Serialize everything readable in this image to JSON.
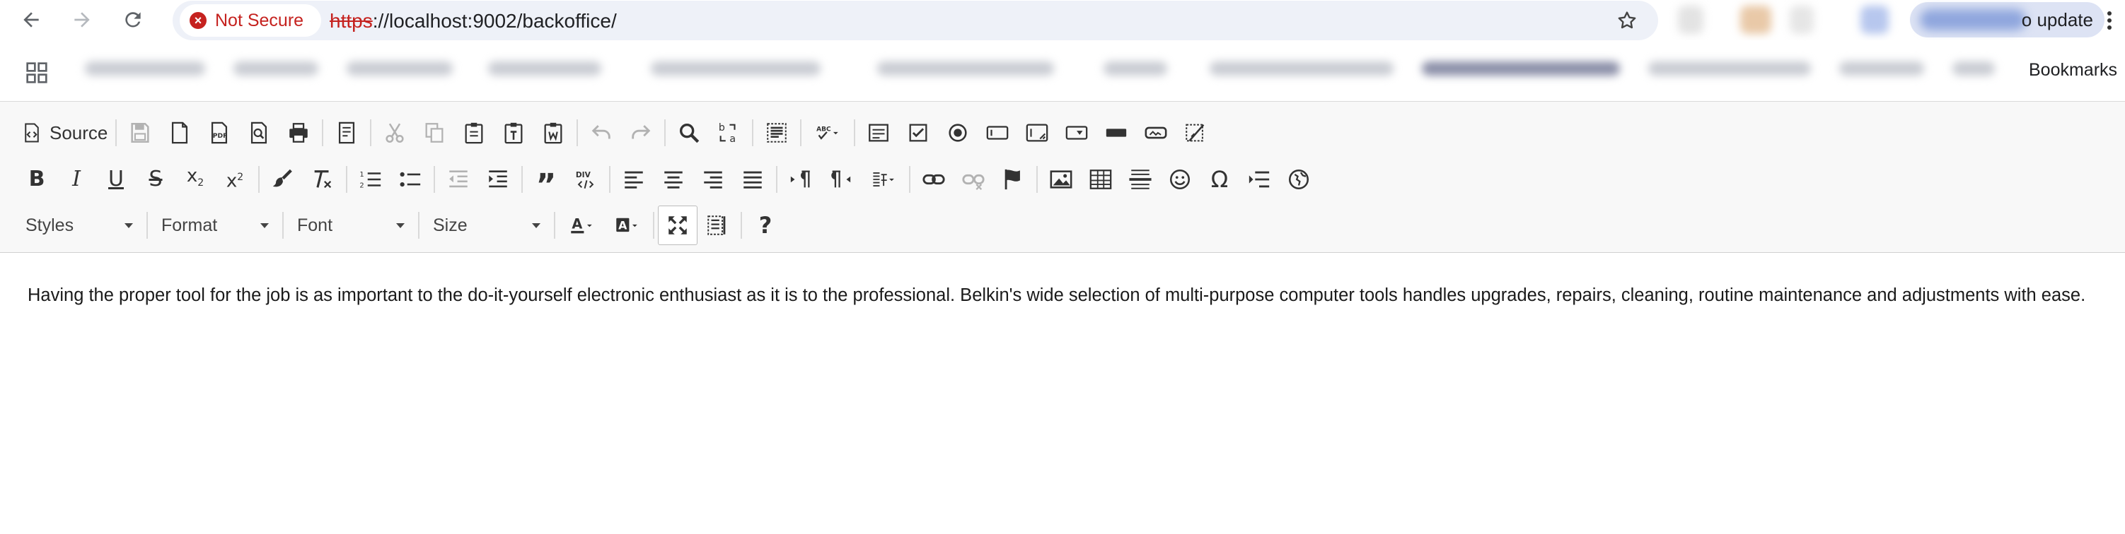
{
  "browser": {
    "security_label": "Not Secure",
    "url_scheme": "https",
    "url_rest": "://localhost:9002/backoffice/",
    "profile_label": "o update",
    "bookmarks_label": "Bookmarks"
  },
  "toolbar": {
    "source_label": "Source",
    "styles_label": "Styles",
    "format_label": "Format",
    "font_label": "Font",
    "size_label": "Size",
    "pdf_text": "PDF",
    "abc_text": "ABC",
    "div_text": "DIV",
    "help_text": "?",
    "omega_text": "Ω"
  },
  "content": {
    "paragraph": "Having the proper tool for the job is as important to the do-it-yourself electronic enthusiast as it is to the professional. Belkin's wide selection of multi-purpose computer tools handles upgrades, repairs, cleaning, routine maintenance and adjustments with ease."
  },
  "colors": {
    "danger": "#c5221f",
    "omnibox": "#eef1f8",
    "toolbar_bg": "#f8f8f8",
    "icon": "#333333"
  }
}
